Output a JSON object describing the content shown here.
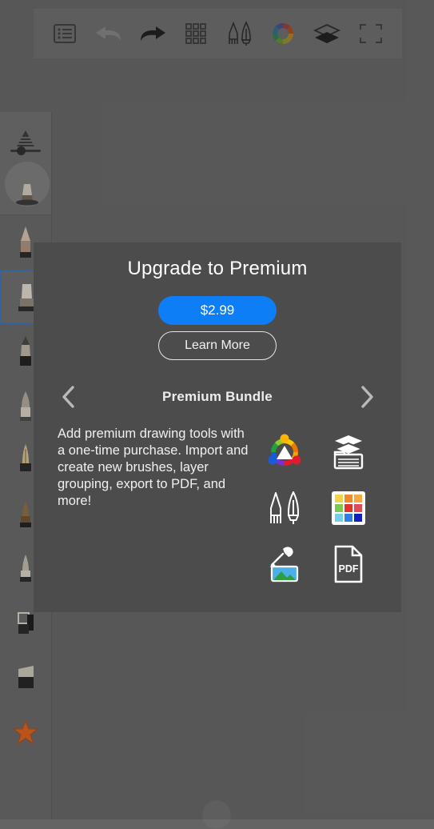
{
  "app": {
    "background_color": "#646464",
    "dialog_color": "#4c4c4c",
    "accent_color": "#0d7ef5"
  },
  "toolbar": {
    "items": [
      {
        "name": "menu-list-icon",
        "label": "Menu"
      },
      {
        "name": "undo-arrow-icon",
        "label": "Undo"
      },
      {
        "name": "redo-arrow-icon",
        "label": "Redo"
      },
      {
        "name": "grid-icon",
        "label": "Grid"
      },
      {
        "name": "brush-pen-icon",
        "label": "Brushes"
      },
      {
        "name": "color-wheel-icon",
        "label": "Color"
      },
      {
        "name": "layers-icon",
        "label": "Layers"
      },
      {
        "name": "fullscreen-icon",
        "label": "Fullscreen"
      }
    ]
  },
  "sidebar": {
    "brush_size_label": "Brush Size",
    "preview_label": "Brush Preview",
    "brushes": [
      {
        "name": "brush-pencil",
        "selected": false
      },
      {
        "name": "brush-flat-stamp",
        "selected": true
      },
      {
        "name": "brush-marker",
        "selected": false
      },
      {
        "name": "brush-round-tip",
        "selected": false
      },
      {
        "name": "brush-calligraphy",
        "selected": false
      },
      {
        "name": "brush-bullet-tip",
        "selected": false
      },
      {
        "name": "brush-chisel",
        "selected": false
      },
      {
        "name": "brush-soft-round",
        "selected": false
      },
      {
        "name": "brush-square-flat",
        "selected": false
      },
      {
        "name": "brush-angled-flat",
        "selected": false
      }
    ],
    "favorites_label": "Favorites"
  },
  "dialog": {
    "title": "Upgrade to Premium",
    "price_button": "$2.99",
    "learn_more_button": "Learn More",
    "prev_label": "Previous bundle",
    "next_label": "Next bundle",
    "bundle_name": "Premium Bundle",
    "description": "Add premium drawing tools with a one-time purchase. Import and create new brushes, layer grouping, export to PDF, and more!",
    "features": [
      {
        "name": "color-triangle-icon",
        "label": "Color picker triangle"
      },
      {
        "name": "layer-group-icon",
        "label": "Layer grouping"
      },
      {
        "name": "brush-pen-icon",
        "label": "Premium brushes"
      },
      {
        "name": "swatch-palette-icon",
        "label": "Color swatches"
      },
      {
        "name": "eyedropper-image-icon",
        "label": "Import image / eyedropper"
      },
      {
        "name": "pdf-file-icon",
        "label": "PDF",
        "text": "PDF"
      }
    ]
  }
}
